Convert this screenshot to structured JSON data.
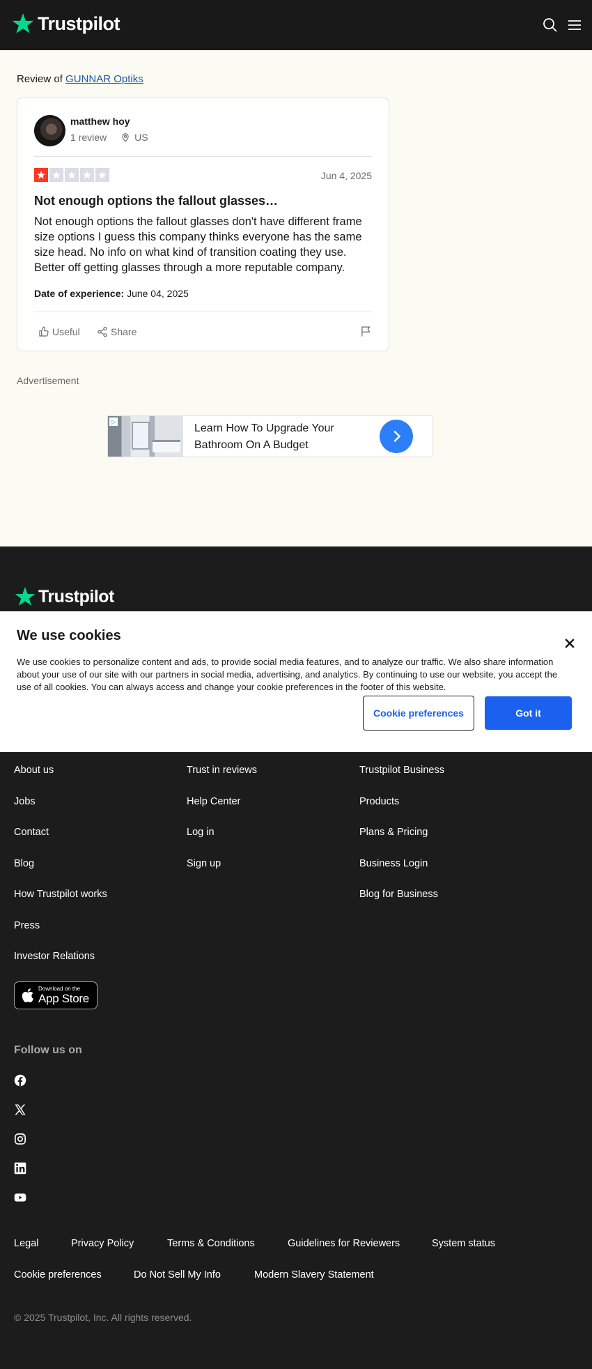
{
  "header": {
    "brand": "Trustpilot",
    "icons": [
      "search-icon",
      "menu-icon"
    ]
  },
  "review_of": {
    "prefix": "Review of",
    "company": "GUNNAR Optiks"
  },
  "review": {
    "author": "matthew hoy",
    "review_count": "1 review",
    "country": "US",
    "rating": 1,
    "max_rating": 5,
    "date": "Jun 4, 2025",
    "title": "Not enough options the fallout glasses…",
    "body": "Not enough options the fallout glasses don't have different frame size options I guess this company thinks everyone has the same size head. No info on what kind of transition coating they use. Better off getting glasses through a more reputable company.",
    "experience_label": "Date of experience:",
    "experience_date": "June 04, 2025",
    "actions": {
      "useful": "Useful",
      "share": "Share"
    }
  },
  "advertisement": {
    "label": "Advertisement",
    "text": "Learn How To Upgrade Your Bathroom On A Budget"
  },
  "footer_brand": "Trustpilot",
  "cookie_banner": {
    "title": "We use cookies",
    "text": "We use cookies to personalize content and ads, to provide social media features, and to analyze our traffic. We also share information about your use of our site with our partners in social media, advertising, and analytics. By continuing to use our website, you accept the use of all cookies. You can always access and change your cookie preferences in the footer of this website.",
    "preferences_button": "Cookie preferences",
    "accept_button": "Got it"
  },
  "footer": {
    "col1": [
      "About us",
      "Jobs",
      "Contact",
      "Blog",
      "How Trustpilot works",
      "Press",
      "Investor Relations"
    ],
    "col2": [
      "Trust in reviews",
      "Help Center",
      "Log in",
      "Sign up"
    ],
    "col3": [
      "Trustpilot Business",
      "Products",
      "Plans & Pricing",
      "Business Login",
      "Blog for Business"
    ],
    "app_store": {
      "small": "Download on the",
      "big": "App Store"
    },
    "follow_us": "Follow us on",
    "social": [
      "facebook-icon",
      "x-icon",
      "instagram-icon",
      "linkedin-icon",
      "youtube-icon"
    ],
    "bottom_row1": [
      "Legal",
      "Privacy Policy",
      "Terms & Conditions",
      "Guidelines for Reviewers",
      "System status"
    ],
    "bottom_row2": [
      "Cookie preferences",
      "Do Not Sell My Info",
      "Modern Slavery Statement"
    ],
    "copyright": "© 2025 Trustpilot, Inc. All rights reserved."
  },
  "colors": {
    "brand_green": "#04da8d",
    "star_red": "#ff3722",
    "link_blue": "#1a61f0",
    "page_bg": "#fbfaf3",
    "footer_bg": "#1c1c1c"
  }
}
